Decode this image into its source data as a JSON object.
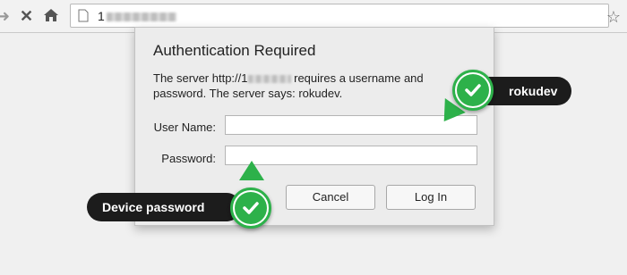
{
  "browser": {
    "url_prefix": "1",
    "icons": {
      "back": "back-arrow-icon",
      "stop": "stop-icon",
      "home": "home-icon",
      "page": "page-icon",
      "bookmark": "star-icon"
    }
  },
  "dialog": {
    "title": "Authentication Required",
    "message_prefix": "The server http://1",
    "message_suffix": " requires a username and password. The server says: rokudev.",
    "username_label": "User Name:",
    "password_label": "Password:",
    "username_value": "",
    "password_value": "",
    "cancel_label": "Cancel",
    "login_label": "Log In"
  },
  "callouts": {
    "username": "rokudev",
    "password": "Device password"
  },
  "colors": {
    "accent_green": "#2db14a",
    "callout_bg": "#1c1c1c"
  }
}
